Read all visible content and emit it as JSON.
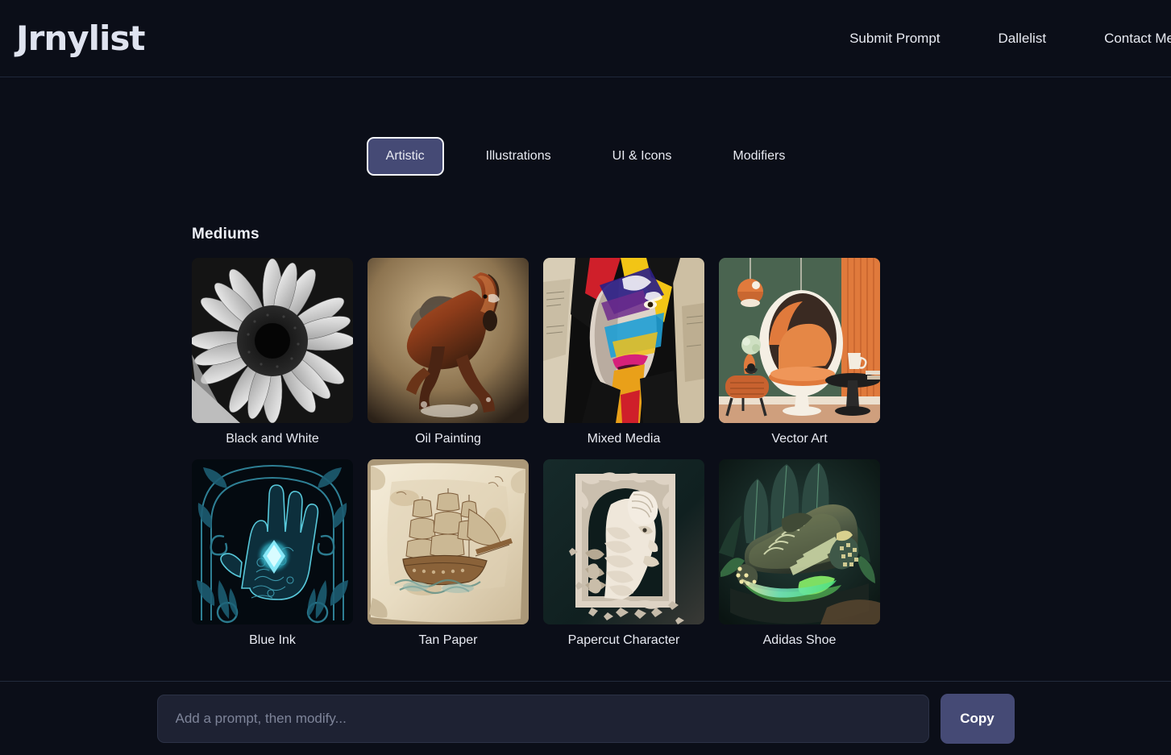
{
  "header": {
    "logo": "Jrnylist",
    "nav": [
      {
        "label": "Submit Prompt"
      },
      {
        "label": "Dallelist"
      },
      {
        "label": "Contact Me"
      }
    ]
  },
  "tabs": [
    {
      "label": "Artistic",
      "active": true
    },
    {
      "label": "Illustrations",
      "active": false
    },
    {
      "label": "UI & Icons",
      "active": false
    },
    {
      "label": "Modifiers",
      "active": false
    }
  ],
  "main": {
    "section_title": "Mediums",
    "cards": [
      {
        "label": "Black and White",
        "art": "bw-sunflower"
      },
      {
        "label": "Oil Painting",
        "art": "oil-horse"
      },
      {
        "label": "Mixed Media",
        "art": "mixed-media-portrait"
      },
      {
        "label": "Vector Art",
        "art": "vector-interior"
      },
      {
        "label": "Blue Ink",
        "art": "blue-ink-hand"
      },
      {
        "label": "Tan Paper",
        "art": "tan-paper-ship"
      },
      {
        "label": "Papercut Character",
        "art": "papercut-bearded-man"
      },
      {
        "label": "Adidas Shoe",
        "art": "glowing-sneaker"
      }
    ]
  },
  "bottom_bar": {
    "input_placeholder": "Add a prompt, then modify...",
    "input_value": "",
    "copy_label": "Copy"
  },
  "colors": {
    "page_bg": "#0b0e18",
    "accent": "#454a75",
    "text": "#e8eaf2",
    "muted_text": "#7e8499",
    "border": "#20273a"
  }
}
